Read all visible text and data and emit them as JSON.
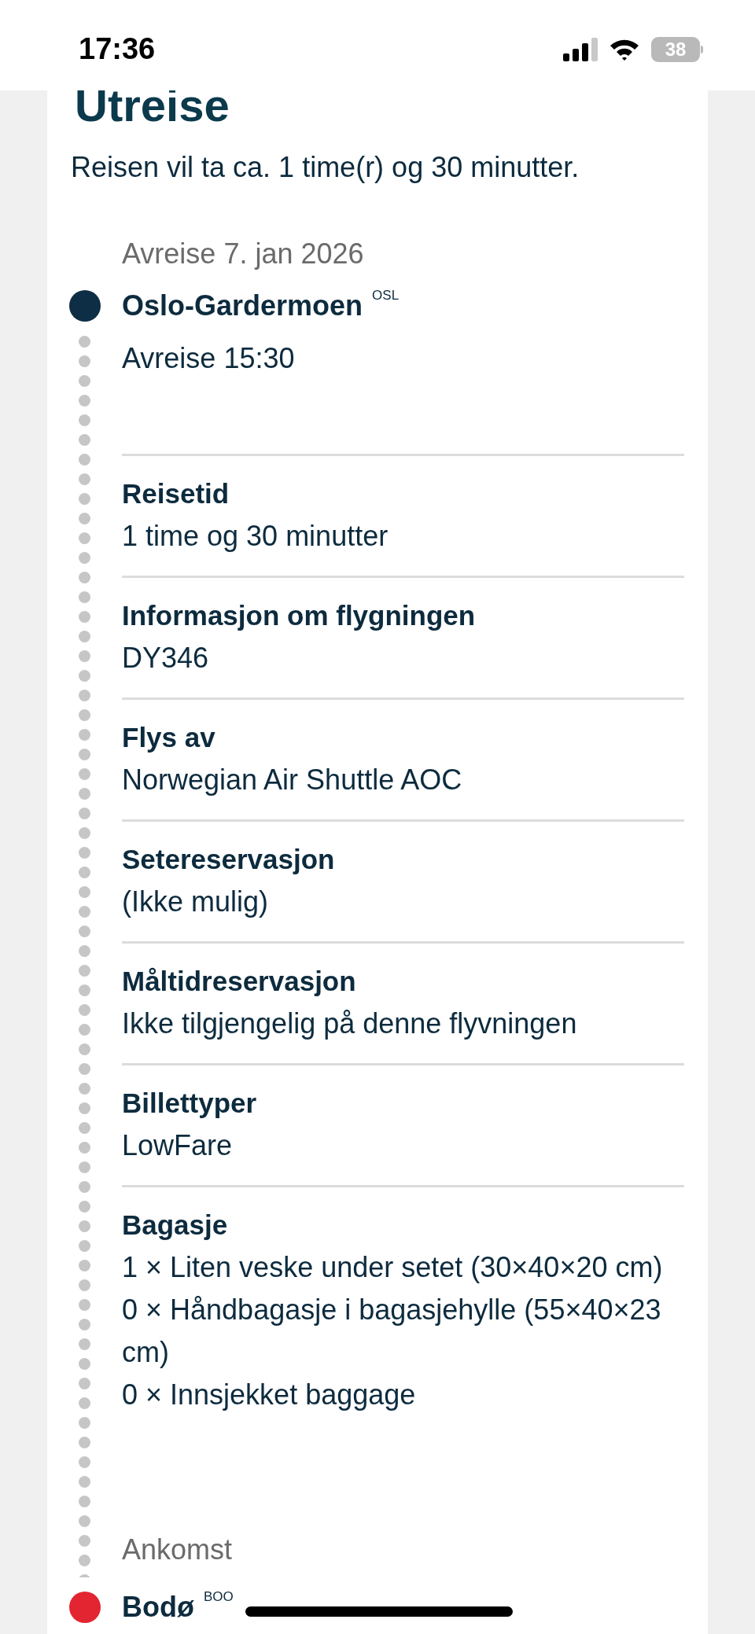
{
  "status_bar": {
    "time": "17:36",
    "battery": "38"
  },
  "section": {
    "title": "Utreise",
    "summary": "Reisen vil ta ca. 1 time(r) og 30 minutter."
  },
  "departure": {
    "label": "Avreise 7. jan 2026",
    "airport": "Oslo-Gardermoen",
    "code": "OSL",
    "time": "Avreise 15:30",
    "color": "#0d2e45"
  },
  "details": [
    {
      "label": "Reisetid",
      "lines": [
        "1 time og 30 minutter"
      ]
    },
    {
      "label": "Informasjon om flygningen",
      "lines": [
        "DY346"
      ]
    },
    {
      "label": "Flys av",
      "lines": [
        "Norwegian Air Shuttle AOC"
      ]
    },
    {
      "label": "Setereservasjon",
      "lines": [
        "(Ikke mulig)"
      ]
    },
    {
      "label": "Måltidreservasjon",
      "lines": [
        "Ikke tilgjengelig på denne flyvningen"
      ]
    },
    {
      "label": "Billettyper",
      "lines": [
        "LowFare"
      ]
    },
    {
      "label": "Bagasje",
      "lines": [
        "1 × Liten veske under setet (30×40×20 cm)",
        "0 × Håndbagasje i bagasjehylle (55×40×23 cm)",
        "0 × Innsjekket baggage"
      ]
    }
  ],
  "arrival": {
    "label": "Ankomst",
    "airport": "Bodø",
    "code": "BOO",
    "color": "#e32531"
  }
}
